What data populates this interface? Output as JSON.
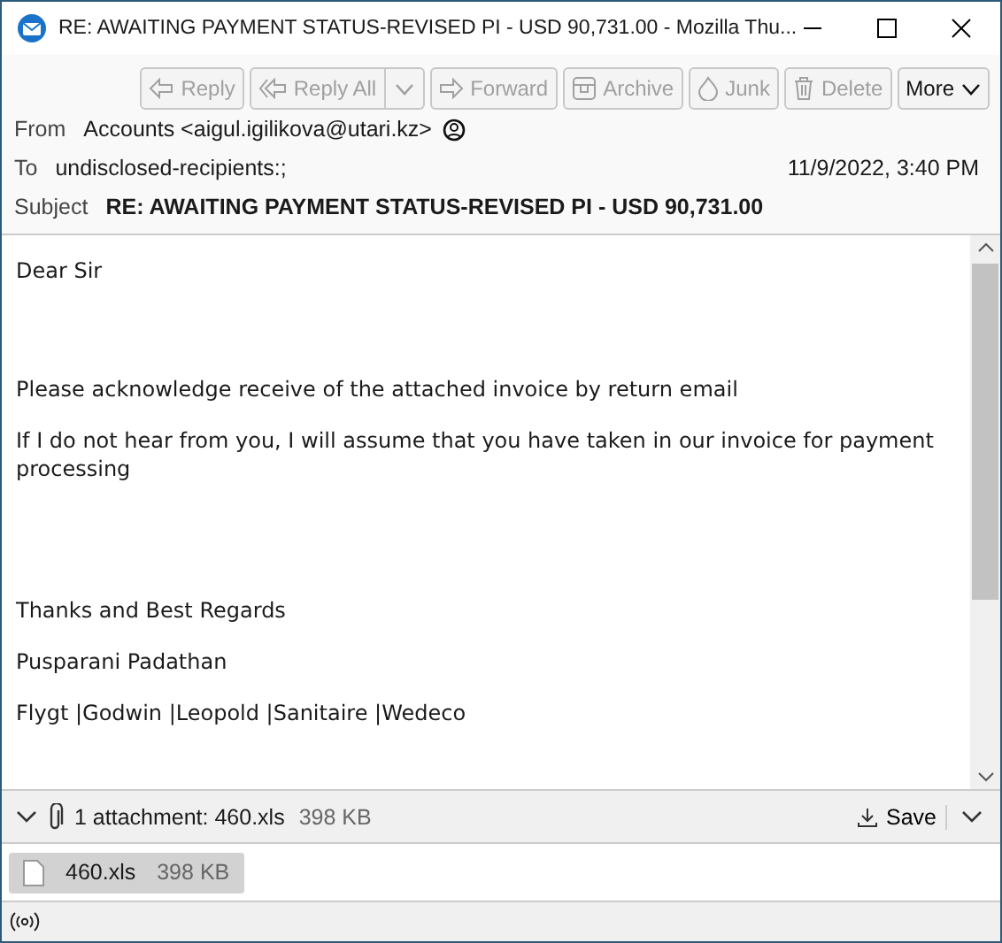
{
  "window": {
    "title": "RE: AWAITING PAYMENT STATUS-REVISED PI - USD 90,731.00 - Mozilla Thu..."
  },
  "toolbar": [
    {
      "kind": "reply",
      "label": "Reply",
      "disabled": true
    },
    {
      "kind": "reply_all",
      "label": "Reply All",
      "disabled": true
    },
    {
      "kind": "forward",
      "label": "Forward",
      "disabled": true
    },
    {
      "kind": "archive",
      "label": "Archive",
      "disabled": true
    },
    {
      "kind": "junk",
      "label": "Junk",
      "disabled": true
    },
    {
      "kind": "delete",
      "label": "Delete",
      "disabled": true
    },
    {
      "kind": "more",
      "label": "More",
      "disabled": false
    }
  ],
  "header": {
    "from_label": "From",
    "from": "Accounts <aigul.igilikova@utari.kz>",
    "to_label": "To",
    "to": "undisclosed-recipients:;",
    "date": "11/9/2022, 3:40 PM",
    "subject_label": "Subject",
    "subject": "RE: AWAITING PAYMENT STATUS-REVISED PI - USD 90,731.00"
  },
  "body": [
    "Dear Sir",
    "Please acknowledge receive of the attached invoice by return email",
    "If I do not hear from you, I will assume that you have taken in our invoice for payment processing",
    "Thanks and Best Regards",
    "Pusparani Padathan",
    "Flygt |Godwin |Leopold |Sanitaire |Wedeco"
  ],
  "attachment_bar": {
    "expanded": true,
    "summary": "1 attachment: 460.xls",
    "size": "398 KB",
    "save": "Save"
  },
  "attachments": [
    {
      "name": "460.xls",
      "size": "398 KB"
    }
  ]
}
